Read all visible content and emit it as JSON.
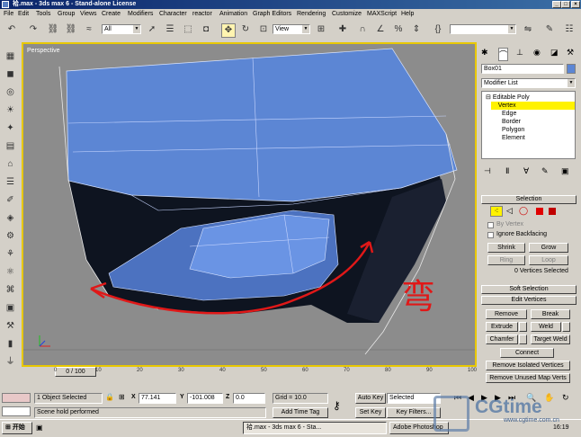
{
  "window": {
    "title": "袷.max - 3ds max 6 - Stand-alone License"
  },
  "menu": [
    "File",
    "Edit",
    "Tools",
    "Group",
    "Views",
    "Create",
    "Modifiers",
    "Character",
    "reactor",
    "Animation",
    "Graph Editors",
    "Rendering",
    "Customize",
    "MAXScript",
    "Help"
  ],
  "toolbar": {
    "selection_filter": "All",
    "ref_coord": "View"
  },
  "viewport": {
    "label": "Perspective",
    "annotation": "弯 曲"
  },
  "timeline": {
    "frame": "0 / 100",
    "ticks": [
      "0",
      "10",
      "20",
      "30",
      "40",
      "50",
      "60",
      "70",
      "80",
      "90",
      "100"
    ]
  },
  "command_panel": {
    "object_name": "Box01",
    "object_color": "#5c86d4",
    "modifier_list": "Modifier List",
    "stack": [
      "Editable Poly",
      "Vertex",
      "Edge",
      "Border",
      "Polygon",
      "Element"
    ],
    "selection_rollout": "Selection",
    "by_vertex": "By Vertex",
    "ignore_backfacing": "Ignore Backfacing",
    "shrink": "Shrink",
    "grow": "Grow",
    "ring": "Ring",
    "loop": "Loop",
    "selected_count": "0 Vertices Selected",
    "soft_selection": "Soft Selection",
    "edit_vertices": "Edit Vertices",
    "remove": "Remove",
    "break": "Break",
    "extrude": "Extrude",
    "weld": "Weld",
    "chamfer": "Chamfer",
    "target_weld": "Target Weld",
    "connect": "Connect",
    "remove_isolated": "Remove Isolated Vertices",
    "remove_unused": "Remove Unused Map Verts"
  },
  "status": {
    "selected": "1 Object Selected",
    "prompt": "Scene hold performed",
    "x_label": "X",
    "x": "77.141",
    "y_label": "Y",
    "y": "-101.008",
    "z_label": "Z",
    "z": "0.0",
    "grid": "Grid = 10.0",
    "add_time_tag": "Add Time Tag",
    "auto_key": "Auto Key",
    "key_mode": "Selected",
    "set_key": "Set Key",
    "key_filters": "Key Filters..."
  },
  "taskbar": {
    "start": "开始",
    "tasks": [
      "袷.max - 3ds max 6 - Sta...",
      "Adobe Photoshop"
    ],
    "clock": "16:19"
  },
  "watermark": {
    "brand": "CGtime",
    "url": "www.cgtime.com.cn"
  }
}
